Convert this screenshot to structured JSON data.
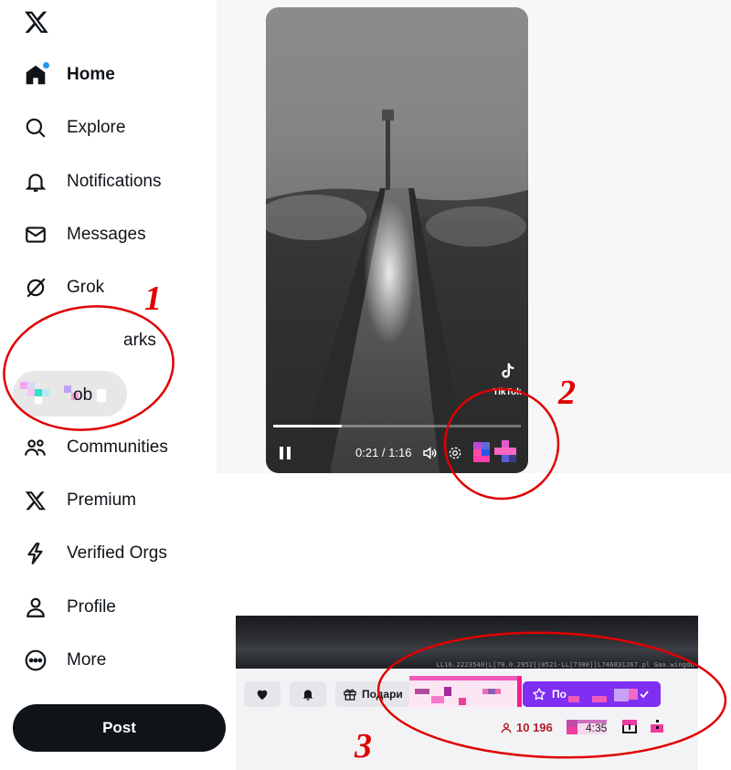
{
  "sidebar": {
    "logo_icon": "x-logo-icon",
    "items": [
      {
        "label": "Home",
        "icon": "home-icon",
        "active": true
      },
      {
        "label": "Explore",
        "icon": "search-icon"
      },
      {
        "label": "Notifications",
        "icon": "bell-icon"
      },
      {
        "label": "Messages",
        "icon": "envelope-icon"
      },
      {
        "label": "Grok",
        "icon": "grok-icon"
      },
      {
        "label": "arks",
        "icon": "bookmark-icon",
        "note": "partially hidden label"
      },
      {
        "label": "ob",
        "icon": "pixelated-icon",
        "note": "partially hidden label"
      },
      {
        "label": "Communities",
        "icon": "communities-icon"
      },
      {
        "label": "Premium",
        "icon": "x-premium-icon"
      },
      {
        "label": "Verified Orgs",
        "icon": "lightning-icon"
      },
      {
        "label": "Profile",
        "icon": "person-icon"
      },
      {
        "label": "More",
        "icon": "more-circle-icon"
      }
    ],
    "post_label": "Post"
  },
  "video": {
    "time_display": "0:21 / 1:16",
    "progress": 0.276,
    "watermark": "TikTok",
    "watermark_handle": "@..."
  },
  "stream": {
    "overlay_text": "LL16.2223540|L[70.0.2952]|0521-LL[7300][L746831267.pl Gaa.wingdb",
    "gift_label": "Подари",
    "subscribe_label": "По",
    "viewer_count": "10 196",
    "uptime": "4:35"
  },
  "annotations": {
    "color": "#e00000",
    "labels": [
      "1",
      "2",
      "3"
    ]
  }
}
